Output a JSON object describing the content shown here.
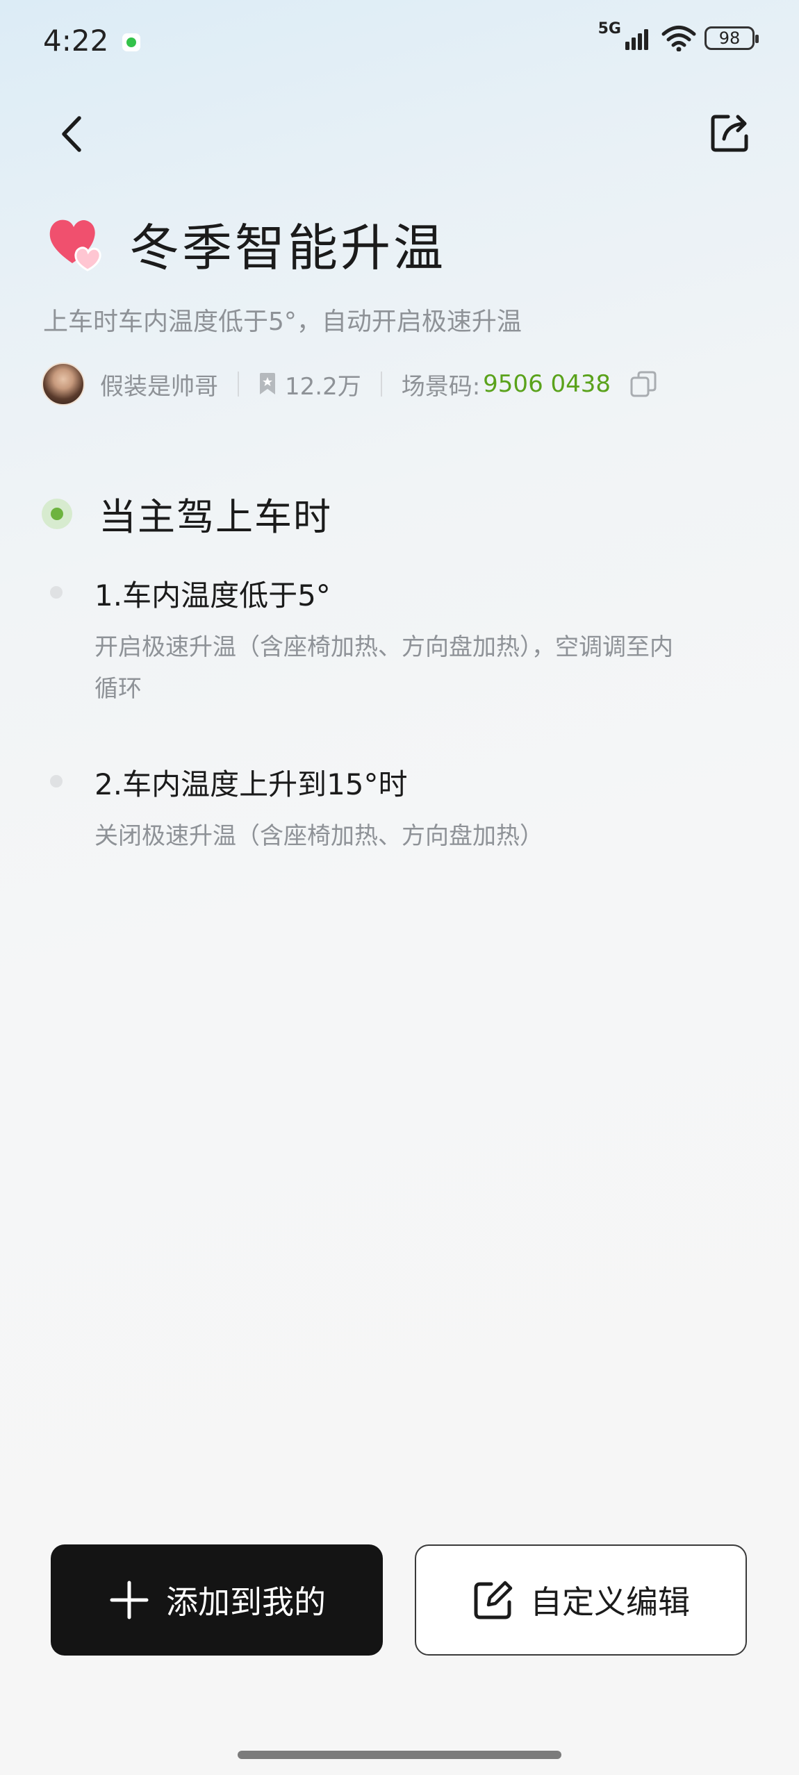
{
  "status_bar": {
    "time": "4:22",
    "network": "5G",
    "battery": "98",
    "icons": [
      "app-notification-icon",
      "signal-icon",
      "wifi-icon",
      "battery-icon"
    ]
  },
  "nav": {
    "back_icon": "chevron-left-icon",
    "share_icon": "share-icon"
  },
  "header": {
    "icon": "heart-icon",
    "title": "冬季智能升温",
    "subtitle": "上车时车内温度低于5°，自动开启极速升温"
  },
  "meta": {
    "author": "假装是帅哥",
    "saves": "12.2万",
    "code_label": "场景码:",
    "code_value": "9506 0438",
    "copy_icon": "copy-icon"
  },
  "trigger": {
    "title": "当主驾上车时"
  },
  "steps": [
    {
      "title": "1.车内温度低于5°",
      "desc_line1": "开启极速升温（含座椅加热、方向盘加热），空调调至内",
      "desc_line2": "循环"
    },
    {
      "title": "2.车内温度上升到15°时",
      "desc_line1": "关闭极速升温（含座椅加热、方向盘加热）"
    }
  ],
  "actions": {
    "add_label": "添加到我的",
    "add_icon": "plus-icon",
    "edit_label": "自定义编辑",
    "edit_icon": "edit-icon"
  },
  "colors": {
    "accent_green": "#5aa21b",
    "trigger_dot": "#6db33f",
    "primary_button": "#141414",
    "heart": "#f0506e"
  }
}
